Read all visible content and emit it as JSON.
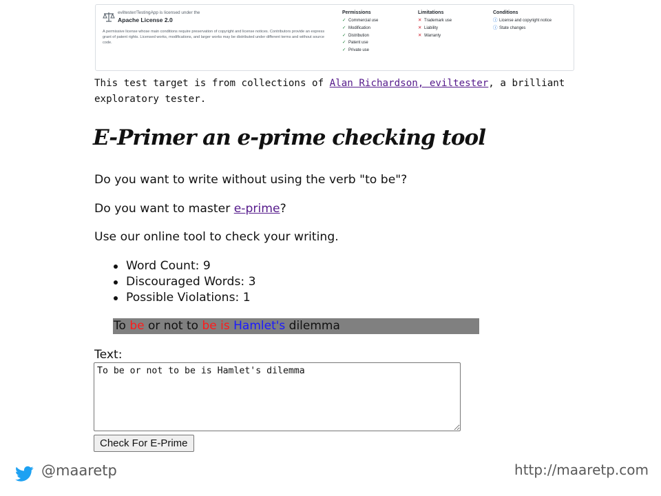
{
  "license": {
    "owner_line": "eviltester/TestingApp is licensed under the",
    "name": "Apache License 2.0",
    "description": "A permissive license whose main conditions require preservation of copyright and license notices. Contributors provide an express grant of patent rights. Licensed works, modifications, and larger works may be distributed under different terms and without source code.",
    "icon": "scale-icon",
    "permissions": {
      "heading": "Permissions",
      "items": [
        "Commercial use",
        "Modification",
        "Distribution",
        "Patent use",
        "Private use"
      ]
    },
    "limitations": {
      "heading": "Limitations",
      "items": [
        "Trademark use",
        "Liability",
        "Warranty"
      ]
    },
    "conditions": {
      "heading": "Conditions",
      "items": [
        "License and copyright notice",
        "State changes"
      ]
    }
  },
  "credit": {
    "prefix": "This test target is from collections of ",
    "link": "Alan Richardson, eviltester",
    "suffix": ", a brilliant exploratory tester."
  },
  "title": "E-Primer an e-prime checking tool",
  "paragraphs": {
    "p1": "Do you want to write without using the verb \"to be\"?",
    "p2_prefix": "Do you want to master ",
    "p2_link": "e-prime",
    "p2_suffix": "?",
    "p3": "Use our online tool to check your writing."
  },
  "stats": [
    "Word Count: 9",
    "Discouraged Words: 3",
    "Possible Violations: 1"
  ],
  "result": {
    "w1": "To ",
    "w2": "be",
    "w3": " or not to ",
    "w4": "be is",
    "w5": " ",
    "w6": "Hamlet's",
    "w7": " dilemma"
  },
  "form": {
    "label": "Text:",
    "text_value": "To be or not to be is Hamlet's dilemma",
    "button_label": "Check For E-Prime"
  },
  "footer": {
    "handle": "@maaretp",
    "url": "http://maaretp.com",
    "icon": "twitter-icon"
  },
  "colors": {
    "link": "#551a8b",
    "discouraged": "#ff1a1a",
    "possible_violation": "#1a1aff",
    "result_background": "#808080"
  }
}
